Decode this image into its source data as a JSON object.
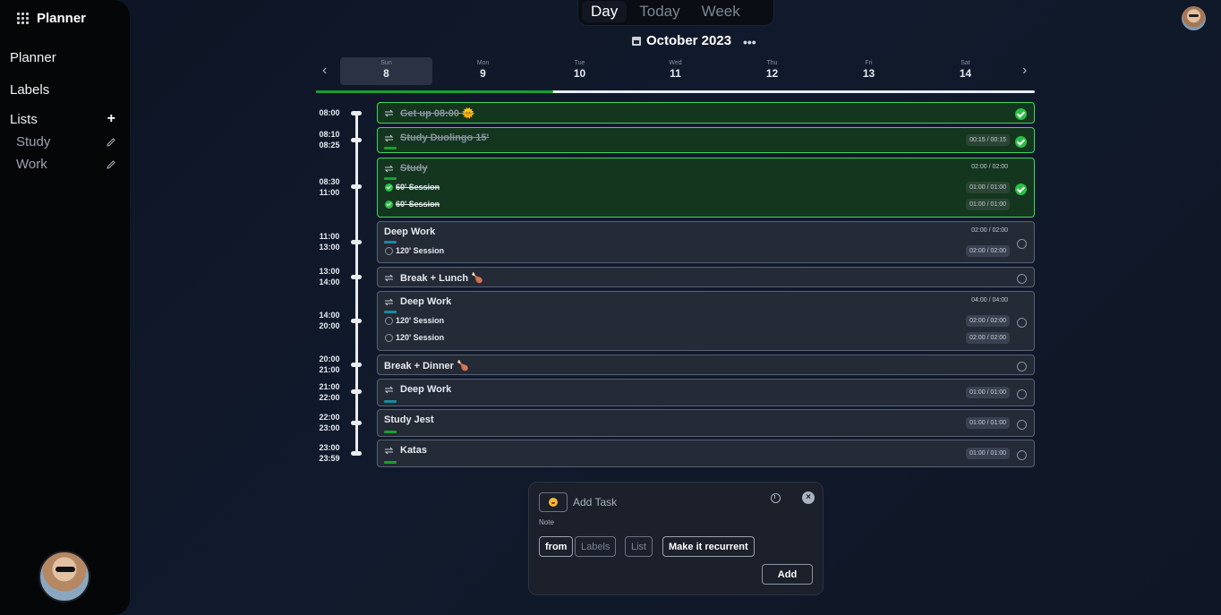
{
  "sidebar": {
    "brand": "Planner",
    "nav": [
      "Planner",
      "Labels"
    ],
    "lists_label": "Lists",
    "lists": [
      "Study",
      "Work"
    ]
  },
  "view_switch": {
    "tabs": [
      "Day",
      "Today",
      "Week"
    ],
    "active": "Day"
  },
  "calendar": {
    "month": "October 2023",
    "days": [
      {
        "name": "Sun",
        "num": "8"
      },
      {
        "name": "Mon",
        "num": "9"
      },
      {
        "name": "Tue",
        "num": "10"
      },
      {
        "name": "Wed",
        "num": "11"
      },
      {
        "name": "Thu",
        "num": "12"
      },
      {
        "name": "Fri",
        "num": "13"
      },
      {
        "name": "Sat",
        "num": "14"
      }
    ],
    "selected_day": "8",
    "progress_fraction": 0.33
  },
  "timeline": [
    {
      "start": "08:00",
      "end": ""
    },
    {
      "start": "08:10",
      "end": "08:25"
    },
    {
      "start": "08:30",
      "end": "11:00"
    },
    {
      "start": "11:00",
      "end": "13:00"
    },
    {
      "start": "13:00",
      "end": "14:00"
    },
    {
      "start": "14:00",
      "end": "20:00"
    },
    {
      "start": "20:00",
      "end": "21:00"
    },
    {
      "start": "21:00",
      "end": "22:00"
    },
    {
      "start": "22:00",
      "end": "23:00"
    },
    {
      "start": "23:00",
      "end": "23:59"
    }
  ],
  "tasks": [
    {
      "title": "Get up 08:00 🌞",
      "done": true,
      "recurring": true
    },
    {
      "title": "Study Duolingo 15'",
      "done": true,
      "recurring": true,
      "time": "00:15 / 00:15"
    },
    {
      "title": "Study",
      "done": true,
      "recurring": true,
      "time": "02:00 / 02:00",
      "sessions": [
        {
          "label": "60' Session",
          "time": "01:00 / 01:00"
        },
        {
          "label": "60' Session",
          "time": "01:00 / 01:00"
        }
      ]
    },
    {
      "title": "Deep Work",
      "done": false,
      "recurring": false,
      "time": "02:00 / 02:00",
      "sessions": [
        {
          "label": "120' Session",
          "time": "02:00 / 02:00"
        }
      ]
    },
    {
      "title": "Break + Lunch 🍗",
      "done": false,
      "recurring": true
    },
    {
      "title": "Deep Work",
      "done": false,
      "recurring": true,
      "time": "04:00 / 04:00",
      "sessions": [
        {
          "label": "120' Session",
          "time": "02:00 / 02:00"
        },
        {
          "label": "120' Session",
          "time": "02:00 / 02:00"
        }
      ]
    },
    {
      "title": "Break + Dinner 🍗",
      "done": false,
      "recurring": false
    },
    {
      "title": "Deep Work",
      "done": false,
      "recurring": true,
      "time": "01:00 / 01:00"
    },
    {
      "title": "Study Jest",
      "done": false,
      "recurring": false,
      "time": "01:00 / 01:00"
    },
    {
      "title": "Katas",
      "done": false,
      "recurring": true,
      "time": "01:00 / 01:00"
    }
  ],
  "colors": {
    "done_bg": "#14361f",
    "done_border": "#3dd75e",
    "study_bar": "#16a12e",
    "work_bar": "#1a8aa0",
    "progress": "#16a12e"
  },
  "add_task": {
    "placeholder": "Add Task",
    "note_label": "Note",
    "from_label": "from",
    "labels_label": "Labels",
    "list_label": "List",
    "recurrent_label": "Make it recurrent",
    "add_label": "Add"
  }
}
